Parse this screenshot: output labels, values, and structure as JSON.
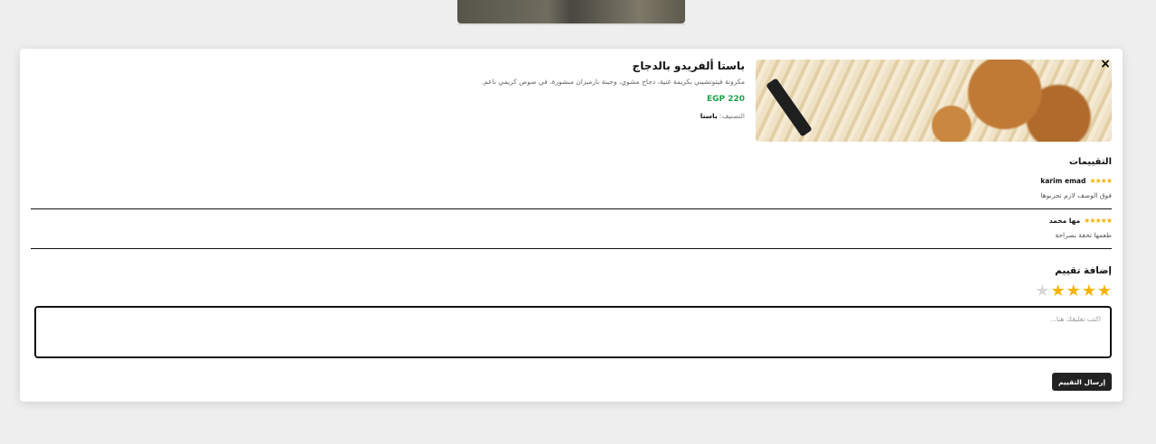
{
  "dish": {
    "title": "باستا ألفريدو بالدجاج",
    "description": "مكرونة فيتوتشيني بكريمة غنية، دجاج مشوي، وجبنة بارميزان مبشورة، في صوص كريمي ناعم.",
    "price": "EGP 220",
    "category_label": "التصنيف:",
    "category_value": "باستا"
  },
  "close_label": "×",
  "reviews": {
    "heading": "التقييمات",
    "items": [
      {
        "name": "karim emad",
        "stars": 4,
        "stars_text": "★★★★",
        "text": "فوق الوصف لازم تجربوها"
      },
      {
        "name": "مها محمد",
        "stars": 5,
        "stars_text": "★★★★★",
        "text": "طعمها تحفة بصراحة"
      }
    ]
  },
  "add_review": {
    "heading": "إضافة تقييم",
    "rating": 4,
    "max_rating": 5,
    "placeholder": "اكتب تعليقك هنا...",
    "submit_label": "إرسال التقييم"
  },
  "colors": {
    "star": "#f5b301",
    "price": "#1aa34a",
    "button": "#222222"
  },
  "icons": {
    "close": "close-icon",
    "star": "star-icon"
  }
}
